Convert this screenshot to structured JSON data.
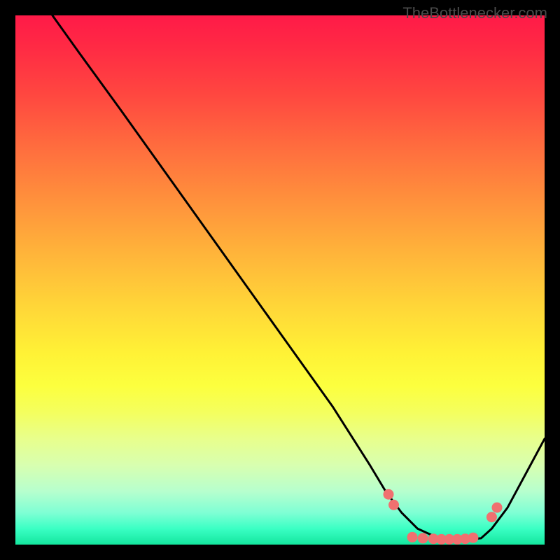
{
  "watermark": "TheBottlenecker.com",
  "chart_data": {
    "type": "line",
    "title": "",
    "xlabel": "",
    "ylabel": "",
    "xlim": [
      0,
      100
    ],
    "ylim": [
      0,
      100
    ],
    "series": [
      {
        "name": "curve",
        "x": [
          7,
          12,
          20,
          30,
          40,
          50,
          60,
          67,
          70,
          73,
          76,
          80,
          84,
          88,
          90,
          93,
          100
        ],
        "y": [
          100,
          93,
          82,
          68,
          54,
          40,
          26,
          15,
          10,
          6,
          3,
          1.2,
          0.8,
          1.2,
          3,
          7,
          20
        ]
      }
    ],
    "markers": {
      "name": "dots",
      "color": "#f07070",
      "x": [
        70.5,
        71.5,
        75,
        77,
        79,
        80.5,
        82,
        83.5,
        85,
        86.5,
        90,
        91
      ],
      "y": [
        9.5,
        7.5,
        1.4,
        1.2,
        1.1,
        1.0,
        1.0,
        1.0,
        1.1,
        1.3,
        5.2,
        7.0
      ]
    }
  }
}
